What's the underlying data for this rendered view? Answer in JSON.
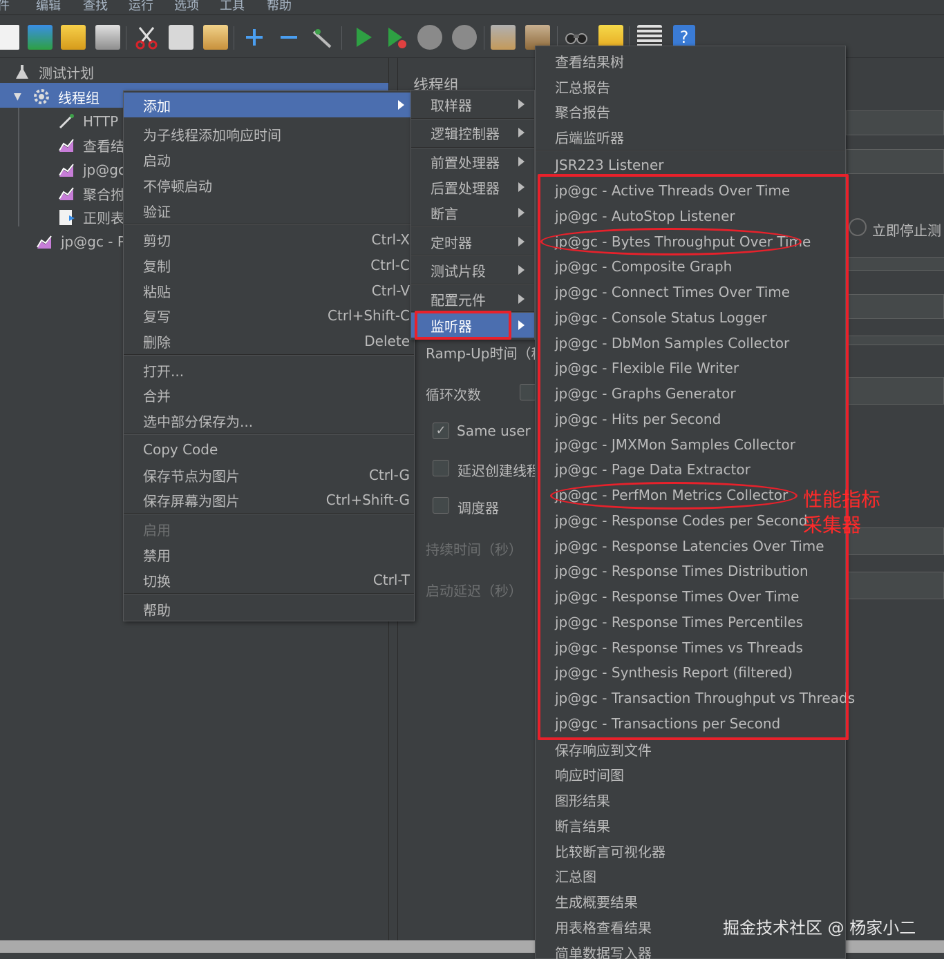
{
  "menubar": [
    "件",
    "编辑",
    "查找",
    "运行",
    "选项",
    "工具",
    "帮助"
  ],
  "toolbar_icons": [
    "new-icon",
    "templates-icon",
    "open-icon",
    "save-icon",
    "cut-icon",
    "copy-icon",
    "paste-icon",
    "expand-icon",
    "collapse-icon",
    "toggle-icon",
    "start-icon",
    "start-no-pause-icon",
    "stop-icon",
    "shutdown-icon",
    "clear-icon",
    "clear-all-icon",
    "search-icon",
    "reset-search-icon",
    "function-helper-icon",
    "help-icon"
  ],
  "tree": {
    "items": [
      {
        "label": "测试计划",
        "icon": "test-plan-icon"
      },
      {
        "label": "线程组",
        "icon": "gear-icon"
      },
      {
        "label": "HTTP",
        "icon": "sampler-icon"
      },
      {
        "label": "查看结",
        "icon": "listener-icon"
      },
      {
        "label": "jp@gc",
        "icon": "listener-icon"
      },
      {
        "label": "聚合拊",
        "icon": "listener-icon"
      },
      {
        "label": "正则表",
        "icon": "extractor-icon"
      },
      {
        "label": "jp@gc - P",
        "icon": "listener-icon"
      }
    ]
  },
  "panel": {
    "title": "线程组",
    "rampup_label": "Ramp-Up时间（秒",
    "loop_label": "循环次数",
    "same_user_label": "Same user o",
    "delay_create_label": "延迟创建线程",
    "scheduler_label": "调度器",
    "duration_label": "持续时间（秒）",
    "startup_delay_label": "启动延迟（秒）",
    "stop_now_label": "立即停止测"
  },
  "context_menu": {
    "items": [
      {
        "label": "添加",
        "shortcut": "",
        "submenu": true,
        "selected": true
      },
      {
        "label": "为子线程添加响应时间",
        "shortcut": ""
      },
      {
        "label": "启动",
        "shortcut": ""
      },
      {
        "label": "不停顿启动",
        "shortcut": ""
      },
      {
        "label": "验证",
        "shortcut": ""
      },
      {
        "label": "剪切",
        "shortcut": "Ctrl-X"
      },
      {
        "label": "复制",
        "shortcut": "Ctrl-C"
      },
      {
        "label": "粘贴",
        "shortcut": "Ctrl-V"
      },
      {
        "label": "复写",
        "shortcut": "Ctrl+Shift-C"
      },
      {
        "label": "删除",
        "shortcut": "Delete"
      },
      {
        "label": "打开...",
        "shortcut": ""
      },
      {
        "label": "合并",
        "shortcut": ""
      },
      {
        "label": "选中部分保存为...",
        "shortcut": ""
      },
      {
        "label": "Copy Code",
        "shortcut": ""
      },
      {
        "label": "保存节点为图片",
        "shortcut": "Ctrl-G"
      },
      {
        "label": "保存屏幕为图片",
        "shortcut": "Ctrl+Shift-G"
      },
      {
        "label": "启用",
        "shortcut": "",
        "disabled": true
      },
      {
        "label": "禁用",
        "shortcut": ""
      },
      {
        "label": "切换",
        "shortcut": "Ctrl-T"
      },
      {
        "label": "帮助",
        "shortcut": ""
      }
    ]
  },
  "add_menu": {
    "items": [
      {
        "label": "取样器"
      },
      {
        "label": "逻辑控制器"
      },
      {
        "label": "前置处理器"
      },
      {
        "label": "后置处理器"
      },
      {
        "label": "断言"
      },
      {
        "label": "定时器"
      },
      {
        "label": "测试片段"
      },
      {
        "label": "配置元件"
      },
      {
        "label": "监听器",
        "selected": true
      }
    ]
  },
  "listener_menu": {
    "items": [
      "查看结果树",
      "汇总报告",
      "聚合报告",
      "后端监听器",
      "JSR223 Listener",
      "jp@gc - Active Threads Over Time",
      "jp@gc - AutoStop Listener",
      "jp@gc - Bytes Throughput Over Time",
      "jp@gc - Composite Graph",
      "jp@gc - Connect Times Over Time",
      "jp@gc - Console Status Logger",
      "jp@gc - DbMon Samples Collector",
      "jp@gc - Flexible File Writer",
      "jp@gc - Graphs Generator",
      "jp@gc - Hits per Second",
      "jp@gc - JMXMon Samples Collector",
      "jp@gc - Page Data Extractor",
      "jp@gc - PerfMon Metrics Collector",
      "jp@gc - Response Codes per Second",
      "jp@gc - Response Latencies Over Time",
      "jp@gc - Response Times Distribution",
      "jp@gc - Response Times Over Time",
      "jp@gc - Response Times Percentiles",
      "jp@gc - Response Times vs Threads",
      "jp@gc - Synthesis Report (filtered)",
      "jp@gc - Transaction Throughput vs Threads",
      "jp@gc - Transactions per Second",
      "保存响应到文件",
      "响应时间图",
      "图形结果",
      "断言结果",
      "比较断言可视化器",
      "汇总图",
      "生成概要结果",
      "用表格查看结果",
      "简单数据写入器"
    ]
  },
  "annotation": {
    "line1": "性能指标",
    "line2": "采集器",
    "color": "#e8212b"
  },
  "watermark": "掘金技术社区 @ 杨家小二",
  "colors": {
    "background": "#3c3f41",
    "selection": "#4b6eaf",
    "text": "#bbbbbb"
  }
}
